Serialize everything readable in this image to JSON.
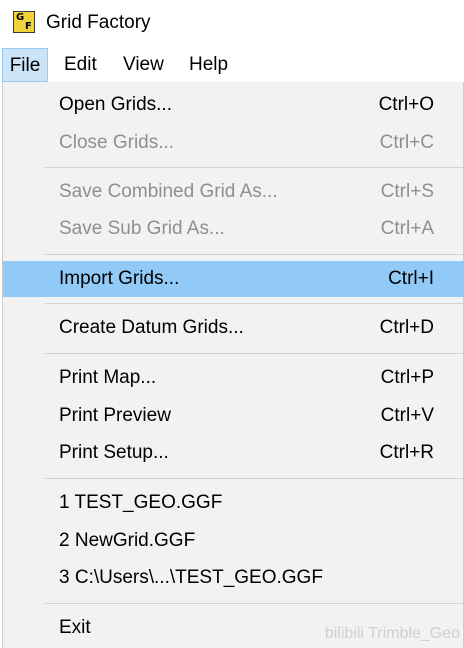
{
  "app": {
    "title": "Grid Factory",
    "icon_letters": [
      "G",
      "F"
    ]
  },
  "menubar": {
    "items": [
      {
        "label": "File",
        "active": true
      },
      {
        "label": "Edit"
      },
      {
        "label": "View"
      },
      {
        "label": "Help"
      }
    ]
  },
  "file_menu": {
    "items": [
      {
        "label": "Open Grids...",
        "shortcut": "Ctrl+O",
        "enabled": true
      },
      {
        "label": "Close Grids...",
        "shortcut": "Ctrl+C",
        "enabled": false
      },
      {
        "label": "Save Combined Grid As...",
        "shortcut": "Ctrl+S",
        "enabled": false
      },
      {
        "label": "Save Sub Grid As...",
        "shortcut": "Ctrl+A",
        "enabled": false
      },
      {
        "label": "Import Grids...",
        "shortcut": "Ctrl+I",
        "enabled": true,
        "highlighted": true
      },
      {
        "label": "Create Datum Grids...",
        "shortcut": "Ctrl+D",
        "enabled": true
      },
      {
        "label": "Print Map...",
        "shortcut": "Ctrl+P",
        "enabled": true
      },
      {
        "label": "Print Preview",
        "shortcut": "Ctrl+V",
        "enabled": true
      },
      {
        "label": "Print Setup...",
        "shortcut": "Ctrl+R",
        "enabled": true
      },
      {
        "label": "1 TEST_GEO.GGF",
        "enabled": true
      },
      {
        "label": "2 NewGrid.GGF",
        "enabled": true
      },
      {
        "label": "3 C:\\Users\\...\\TEST_GEO.GGF",
        "enabled": true
      },
      {
        "label": "Exit",
        "enabled": true
      }
    ]
  },
  "watermark": "bilibili Trimble_Geo",
  "colors": {
    "highlight": "#91c9f7",
    "menubar_active": "#cce4f7",
    "menu_background": "#f2f2f2",
    "disabled_text": "#8f8f8f",
    "icon_fill": "#f2d23b"
  }
}
